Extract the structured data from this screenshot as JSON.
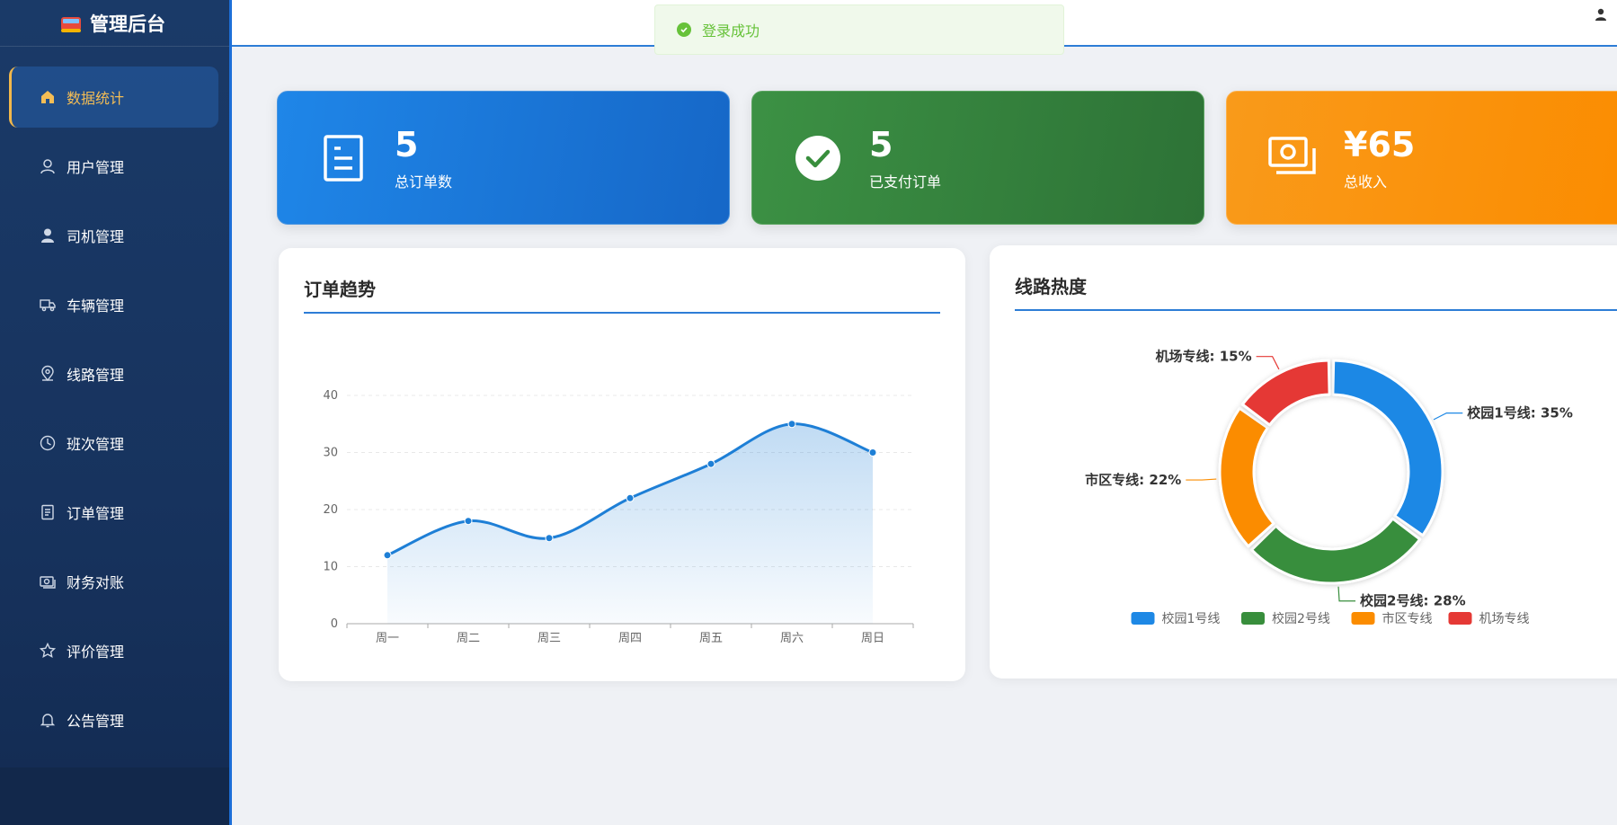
{
  "app": {
    "title": "管理后台"
  },
  "toast": {
    "message": "登录成功"
  },
  "sidebar": {
    "items": [
      {
        "label": "数据统计",
        "icon": "home-icon",
        "active": true
      },
      {
        "label": "用户管理",
        "icon": "user-outline-icon"
      },
      {
        "label": "司机管理",
        "icon": "user-filled-icon"
      },
      {
        "label": "车辆管理",
        "icon": "truck-icon"
      },
      {
        "label": "线路管理",
        "icon": "location-icon"
      },
      {
        "label": "班次管理",
        "icon": "clock-icon"
      },
      {
        "label": "订单管理",
        "icon": "document-icon"
      },
      {
        "label": "财务对账",
        "icon": "money-icon"
      },
      {
        "label": "评价管理",
        "icon": "star-icon"
      },
      {
        "label": "公告管理",
        "icon": "bell-icon"
      }
    ]
  },
  "stats": {
    "total_orders": {
      "value": "5",
      "label": "总订单数",
      "icon": "document-icon",
      "color": "#1e7fe0"
    },
    "paid_orders": {
      "value": "5",
      "label": "已支付订单",
      "icon": "check-circle-icon",
      "color": "#388e3c"
    },
    "revenue": {
      "value": "¥65",
      "label": "总收入",
      "icon": "money-icon",
      "color": "#fb8c00"
    }
  },
  "trend_panel": {
    "title": "订单趋势"
  },
  "route_panel": {
    "title": "线路热度"
  },
  "chart_data": [
    {
      "type": "area",
      "title": "订单趋势",
      "categories": [
        "周一",
        "周二",
        "周三",
        "周四",
        "周五",
        "周六",
        "周日"
      ],
      "values": [
        12,
        18,
        15,
        22,
        28,
        35,
        30
      ],
      "ylim": [
        0,
        40
      ],
      "yticks": [
        0,
        10,
        20,
        30,
        40
      ],
      "color": "#1e7fd6",
      "grid": true
    },
    {
      "type": "pie",
      "subtype": "donut",
      "title": "线路热度",
      "legend": "bottom",
      "slices": [
        {
          "name": "校园1号线",
          "value": 35,
          "label": "校园1号线: 35%",
          "color": "#1e88e5"
        },
        {
          "name": "校园2号线",
          "value": 28,
          "label": "校园2号线: 28%",
          "color": "#388e3c"
        },
        {
          "name": "市区专线",
          "value": 22,
          "label": "市区专线: 22%",
          "color": "#fb8c00"
        },
        {
          "name": "机场专线",
          "value": 15,
          "label": "机场专线: 15%",
          "color": "#e53935"
        }
      ]
    }
  ]
}
